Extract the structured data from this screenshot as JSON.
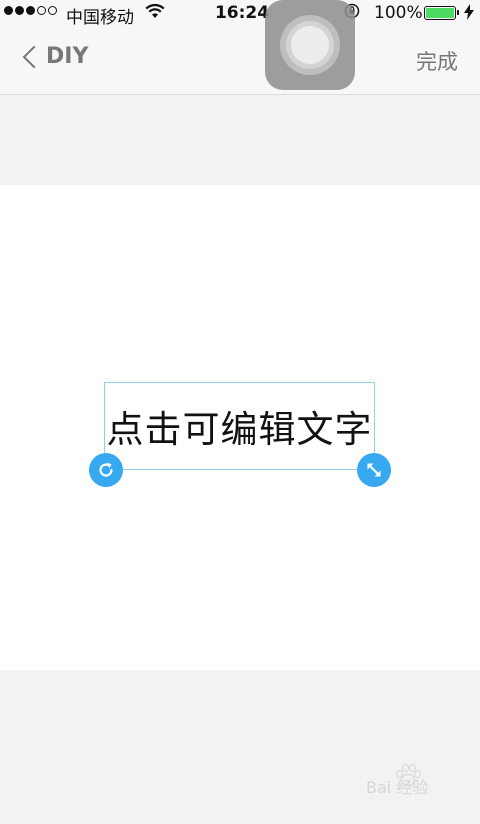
{
  "status_bar": {
    "carrier": "中国移动",
    "time": "16:24",
    "battery": "100%",
    "battery_level": 1.0,
    "signal_bars_filled": 3,
    "signal_bars_total": 5,
    "icons": [
      "signal-dots-icon",
      "wifi-icon",
      "rotation-lock-icon",
      "battery-icon",
      "charging-bolt-icon"
    ]
  },
  "nav": {
    "back_label": "DIY",
    "done_label": "完成"
  },
  "canvas": {
    "text": "点击可编辑文字",
    "rotate_handle_icon": "rotate-icon",
    "resize_handle_icon": "resize-icon"
  },
  "watermark": {
    "text": "Bai 经验"
  },
  "colors": {
    "accent": "#36a9f0",
    "selection_border": "#8fd0ec",
    "battery_green": "#4cd964",
    "nav_text": "#777777",
    "page_background": "#f2f2f2"
  }
}
